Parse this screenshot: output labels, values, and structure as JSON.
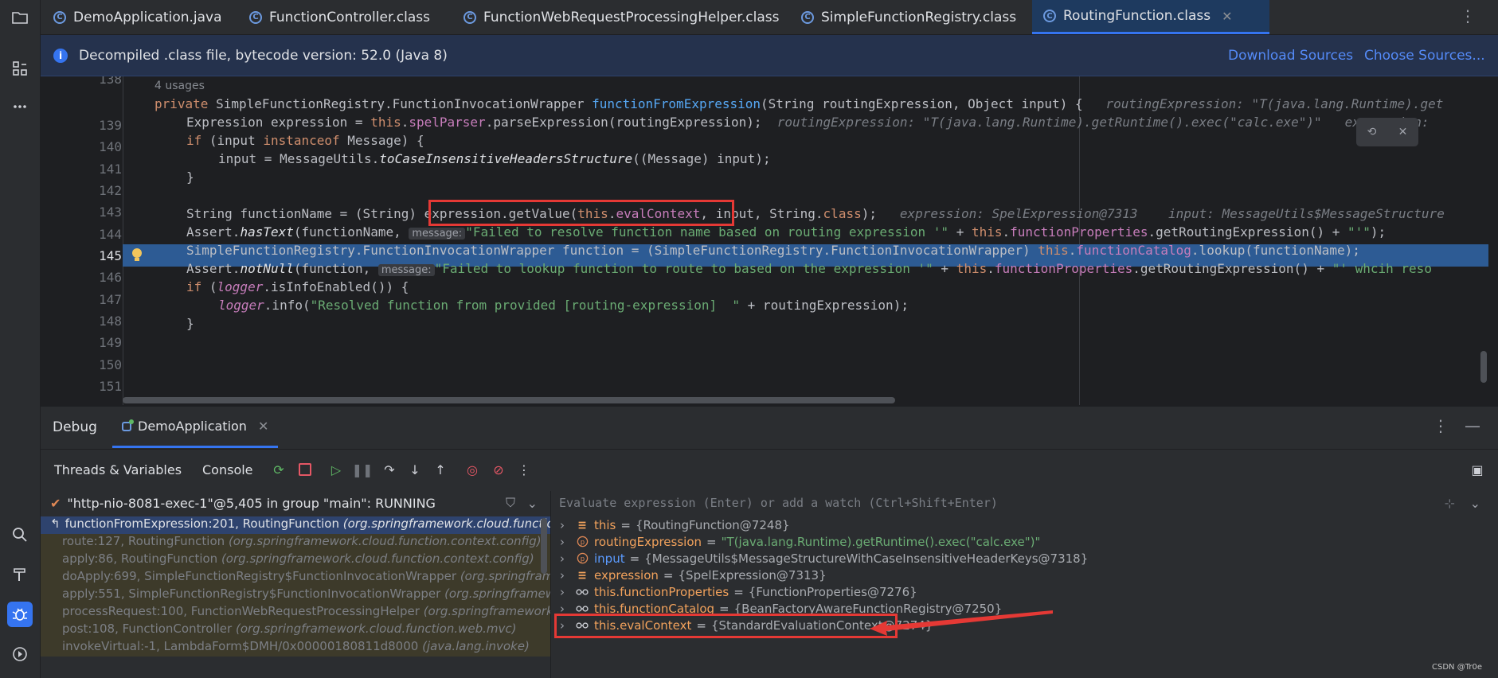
{
  "tabs": [
    {
      "label": "DemoApplication.java",
      "active": false
    },
    {
      "label": "FunctionController.class",
      "active": false
    },
    {
      "label": "FunctionWebRequestProcessingHelper.class",
      "active": false
    },
    {
      "label": "SimpleFunctionRegistry.class",
      "active": false
    },
    {
      "label": "RoutingFunction.class",
      "active": true
    }
  ],
  "banner": {
    "text": "Decompiled .class file, bytecode version: 52.0 (Java 8)",
    "download": "Download Sources",
    "choose": "Choose Sources..."
  },
  "editor": {
    "usages": "4 usages",
    "line_numbers": [
      "138",
      "139",
      "140",
      "141",
      "142",
      "143",
      "144",
      "145",
      "146",
      "147",
      "148",
      "149",
      "150",
      "151"
    ],
    "l139": {
      "kw": "private",
      "type": "SimpleFunctionRegistry.FunctionInvocationWrapper",
      "name": "functionFromExpression",
      "params": "(String routingExpression, Object input) {",
      "hint": "routingExpression: \"T(java.lang.Runtime).get"
    },
    "l140": {
      "a": "Expression expression = ",
      "this": "this",
      "dot": ".",
      "field": "spelParser",
      "b": ".parseExpression(routingExpression);",
      "hint": "routingExpression: \"T(java.lang.Runtime).getRuntime().exec(\"calc.exe\")\"   expression:"
    },
    "l141": {
      "kw": "if",
      "a": " (input ",
      "kw2": "instanceof",
      "b": " Message) {"
    },
    "l142": {
      "a": "input = MessageUtils.",
      "m": "toCaseInsensitiveHeadersStructure",
      "b": "((Message) input);"
    },
    "l143": "}",
    "l145": {
      "a": "String functionName = (String) ",
      "b": "expression.getValue(",
      "this": "this",
      "dot": ".",
      "field": "evalContext",
      "c": ", input, String.",
      "kw": "class",
      "d": ");",
      "hint": "expression: SpelExpression@7313    input: MessageUtils$MessageStructure"
    },
    "l146": {
      "a": "Assert.",
      "m": "hasText",
      "b": "(functionName, ",
      "ph": "message:",
      "s": "\"Failed to resolve function name based on routing expression '\"",
      "c": " + ",
      "this": "this",
      "dot": ".",
      "field": "functionProperties",
      "d": ".getRoutingExpression() + ",
      "s2": "\"'\"",
      "e": ");"
    },
    "l147": {
      "a": "SimpleFunctionRegistry.FunctionInvocationWrapper function = (SimpleFunctionRegistry.FunctionInvocationWrapper) ",
      "this": "this",
      "dot": ".",
      "field": "functionCatalog",
      "b": ".lookup(functionName);"
    },
    "l148": {
      "a": "Assert.",
      "m": "notNull",
      "b": "(function, ",
      "ph": "message:",
      "s": "\"Failed to lookup function to route to based on the expression '\"",
      "c": " + ",
      "this": "this",
      "dot": ".",
      "field": "functionProperties",
      "d": ".getRoutingExpression() + ",
      "s2": "\"' whcih reso"
    },
    "l149": {
      "kw": "if",
      "a": " (",
      "lg": "logger",
      "b": ".isInfoEnabled()) {"
    },
    "l150": {
      "lg": "logger",
      "a": ".info(",
      "s": "\"Resolved function from provided [routing-expression]  \"",
      "b": " + routingExpression);"
    },
    "l151": "}"
  },
  "debug": {
    "title": "Debug",
    "session": "DemoApplication",
    "subtabs": {
      "threads": "Threads & Variables",
      "console": "Console"
    },
    "thread": "\"http-nio-8081-exec-1\"@5,405 in group \"main\": RUNNING",
    "frames": [
      {
        "m": "functionFromExpression:201, RoutingFunction ",
        "p": "(org.springframework.cloud.function.context.conf",
        "selected": true
      },
      {
        "m": "route:127, RoutingFunction ",
        "p": "(org.springframework.cloud.function.context.config)",
        "selected": false
      },
      {
        "m": "apply:86, RoutingFunction ",
        "p": "(org.springframework.cloud.function.context.config)",
        "selected": false
      },
      {
        "m": "doApply:699, SimpleFunctionRegistry$FunctionInvocationWrapper ",
        "p": "(org.springframework.cloud.fu",
        "selected": false
      },
      {
        "m": "apply:551, SimpleFunctionRegistry$FunctionInvocationWrapper ",
        "p": "(org.springframework.cloud.func",
        "selected": false
      },
      {
        "m": "processRequest:100, FunctionWebRequestProcessingHelper ",
        "p": "(org.springframework.cloud.function",
        "selected": false
      },
      {
        "m": "post:108, FunctionController ",
        "p": "(org.springframework.cloud.function.web.mvc)",
        "selected": false
      },
      {
        "m": "invokeVirtual:-1, LambdaForm$DMH/0x00000180811d8000 ",
        "p": "(java.lang.invoke)",
        "selected": false
      }
    ],
    "eval_placeholder": "Evaluate expression (Enter) or add a watch (Ctrl+Shift+Enter)",
    "vars": [
      {
        "icon": "field",
        "name": "this",
        "value": "{RoutingFunction@7248}"
      },
      {
        "icon": "param",
        "name": "routingExpression",
        "value": "\"T(java.lang.Runtime).getRuntime().exec(\"calc.exe\")\""
      },
      {
        "icon": "param",
        "name": "input",
        "value": "{MessageUtils$MessageStructureWithCaseInsensitiveHeaderKeys@7318}"
      },
      {
        "icon": "field",
        "name": "expression",
        "value": "{SpelExpression@7313}"
      },
      {
        "icon": "watch",
        "name": "this.functionProperties",
        "value": "{FunctionProperties@7276}"
      },
      {
        "icon": "watch",
        "name": "this.functionCatalog",
        "value": "{BeanFactoryAwareFunctionRegistry@7250}"
      },
      {
        "icon": "watch",
        "name": "this.evalContext",
        "value": "{StandardEvaluationContext@7274}"
      }
    ]
  },
  "watermark": "CSDN @Tr0e",
  "colors": {
    "highlight": "#2d5b94",
    "annotation": "#e53935",
    "accent": "#3574f0"
  }
}
